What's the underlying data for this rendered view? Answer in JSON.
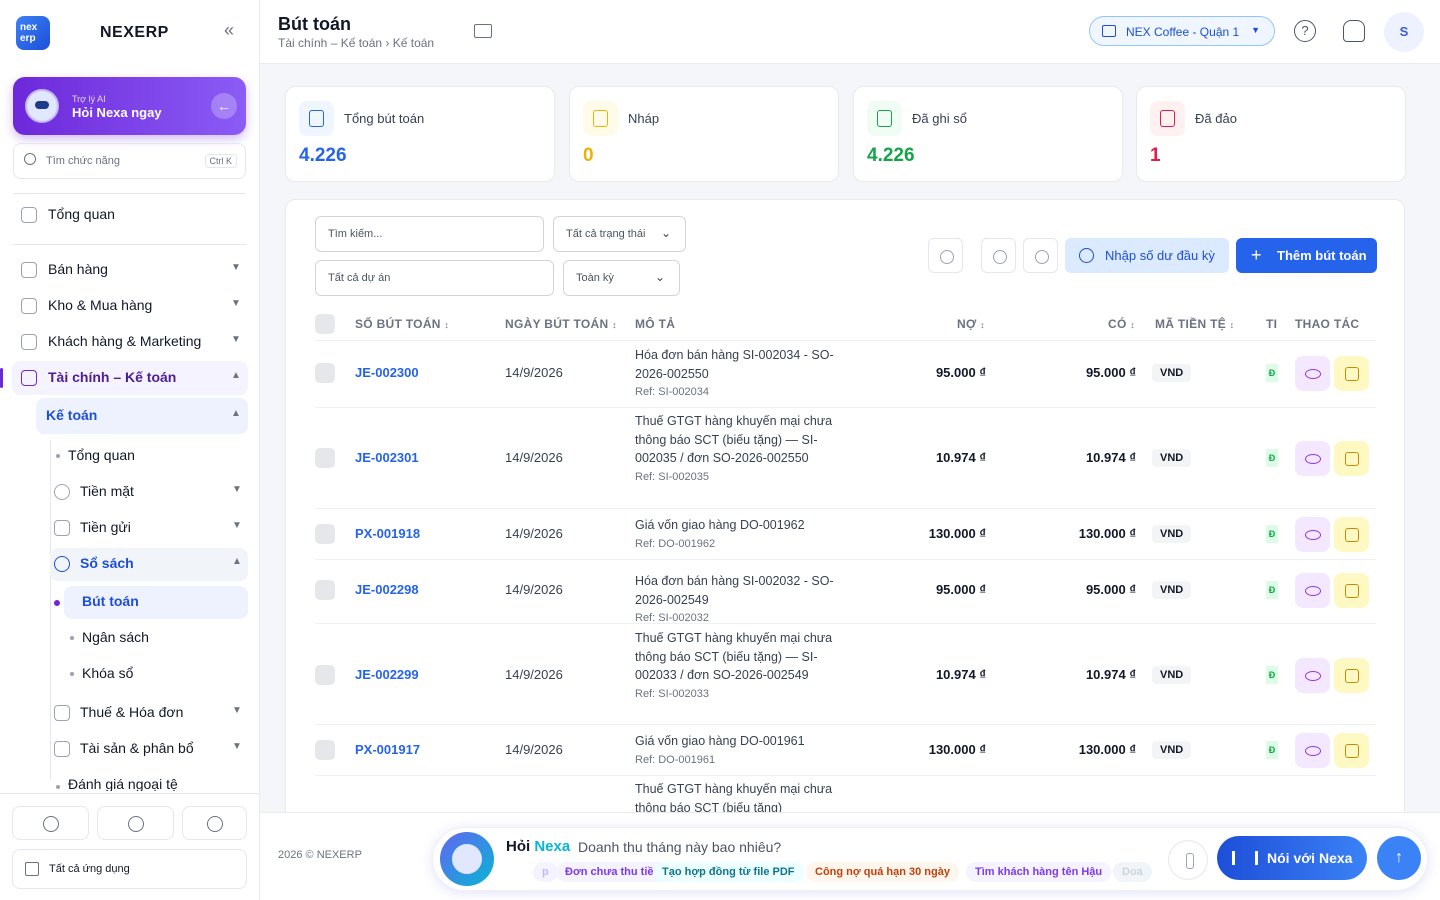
{
  "sidebar": {
    "logo_text": "nex erp",
    "brand": "NEXERP",
    "ai_card": {
      "subtitle": "Trợ lý AI",
      "title": "Hỏi Nexa ngay"
    },
    "search_placeholder": "Tìm chức năng",
    "search_shortcut": "Ctrl K",
    "overview": "Tổng quan",
    "sections": [
      "Bán hàng",
      "Kho & Mua hàng",
      "Khách hàng & Marketing",
      "Tài chính – Kế toán"
    ],
    "accounting": "Kế toán",
    "accounting_items": [
      "Tổng quan",
      "Tiền mặt",
      "Tiền gửi",
      "Sổ sách"
    ],
    "ledger_items": [
      "Bút toán",
      "Ngân sách",
      "Khóa sổ"
    ],
    "more_items": [
      "Thuế & Hóa đơn",
      "Tài sản & phân bổ",
      "Đánh giá ngoại tệ"
    ],
    "all_apps": "Tất cả ứng dụng"
  },
  "header": {
    "title": "Bút toán",
    "breadcrumb": "Tài chính – Kế toán › Kế toán",
    "branch": "NEX Coffee - Quận 1",
    "user_initial": "S"
  },
  "stats": [
    {
      "label": "Tổng bút toán",
      "value": "4.226",
      "color": "#2563eb",
      "bg": "#eff6ff"
    },
    {
      "label": "Nháp",
      "value": "0",
      "color": "#eab308",
      "bg": "#fefce8"
    },
    {
      "label": "Đã ghi sổ",
      "value": "4.226",
      "color": "#16a34a",
      "bg": "#f0fdf4"
    },
    {
      "label": "Đã đảo",
      "value": "1",
      "color": "#e11d48",
      "bg": "#fff1f2"
    }
  ],
  "filters": {
    "search_placeholder": "Tìm kiếm...",
    "status": "Tất cả trạng thái",
    "project": "Tất cả dự án",
    "period": "Toàn kỳ",
    "import_label": "Nhập số dư đầu kỳ",
    "add_label": "Thêm bút toán"
  },
  "table": {
    "headers": {
      "code": "SỐ BÚT TOÁN",
      "date": "NGÀY BÚT TOÁN",
      "desc": "MÔ TẢ",
      "debit": "NỢ",
      "credit": "CÓ",
      "currency": "MÃ TIỀN TỆ",
      "status": "TI",
      "actions": "THAO TÁC"
    },
    "rows": [
      {
        "code": "JE-002300",
        "date": "14/9/2026",
        "desc": "Hóa đơn bán hàng SI-002034 - SO-2026-002550",
        "ref": "Ref: SI-002034",
        "debit": "95.000 ₫",
        "credit": "95.000 ₫",
        "currency": "VND",
        "status": "Đ"
      },
      {
        "code": "JE-002301",
        "date": "14/9/2026",
        "desc": "Thuế GTGT hàng khuyến mại chưa thông báo SCT (biếu tặng) — SI-002035 / đơn SO-2026-002550",
        "ref": "Ref: SI-002035",
        "debit": "10.974 ₫",
        "credit": "10.974 ₫",
        "currency": "VND",
        "status": "Đ"
      },
      {
        "code": "PX-001918",
        "date": "14/9/2026",
        "desc": "Giá vốn giao hàng DO-001962",
        "ref": "Ref: DO-001962",
        "debit": "130.000 ₫",
        "credit": "130.000 ₫",
        "currency": "VND",
        "status": "Đ"
      },
      {
        "code": "JE-002298",
        "date": "14/9/2026",
        "desc": "Hóa đơn bán hàng SI-002032 - SO-2026-002549",
        "ref": "Ref: SI-002032",
        "debit": "95.000 ₫",
        "credit": "95.000 ₫",
        "currency": "VND",
        "status": "Đ"
      },
      {
        "code": "JE-002299",
        "date": "14/9/2026",
        "desc": "Thuế GTGT hàng khuyến mại chưa thông báo SCT (biếu tặng) — SI-002033 / đơn SO-2026-002549",
        "ref": "Ref: SI-002033",
        "debit": "10.974 ₫",
        "credit": "10.974 ₫",
        "currency": "VND",
        "status": "Đ"
      },
      {
        "code": "PX-001917",
        "date": "14/9/2026",
        "desc": "Giá vốn giao hàng DO-001961",
        "ref": "Ref: DO-001961",
        "debit": "130.000 ₫",
        "credit": "130.000 ₫",
        "currency": "VND",
        "status": "Đ"
      },
      {
        "code": "",
        "date": "",
        "desc": "Thuế GTGT hàng khuyến mại chưa thông báo SCT (biếu tặng)",
        "ref": "",
        "debit": "",
        "credit": "",
        "currency": "",
        "status": ""
      }
    ]
  },
  "footer": {
    "copyright": "2026 © NEXERP",
    "chat_title_a": "Hỏi",
    "chat_title_b": "Nexa",
    "chat_question": "Doanh thu tháng này bao nhiêu?",
    "chips": [
      "p",
      "Đơn chưa thu tiền",
      "Tạo hợp đồng từ file PDF",
      "Công nợ quá hạn 30 ngày",
      "Tìm khách hàng tên Hậu",
      "Doa"
    ],
    "talk_label": "Nói với Nexa"
  }
}
